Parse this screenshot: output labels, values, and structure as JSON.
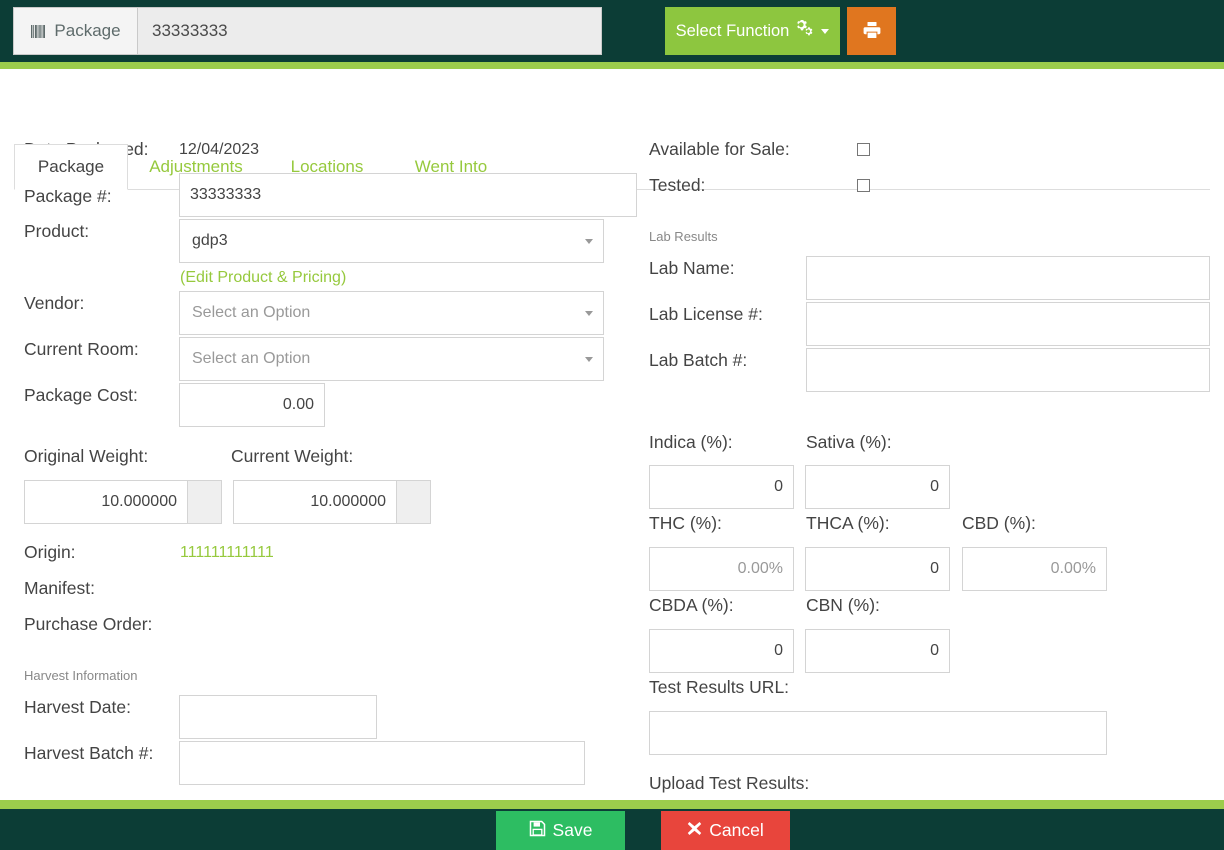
{
  "topbar": {
    "scan_label": "Package",
    "scan_icon": "barcode-icon",
    "scan_value": "33333333",
    "scan_placeholder": "",
    "select_function_label": "Select Function",
    "select_function_icon": "cogs-icon",
    "print_icon": "printer-icon"
  },
  "tabs": [
    {
      "label": "Package",
      "active": true
    },
    {
      "label": "Adjustments",
      "active": false
    },
    {
      "label": "Locations",
      "active": false
    },
    {
      "label": "Went Into",
      "active": false
    }
  ],
  "left": {
    "date_packaged_label": "Date Packaged:",
    "date_packaged_value": "12/04/2023",
    "package_num_label": "Package #:",
    "package_num_value": "33333333",
    "product_label": "Product:",
    "product_value": "gdp3",
    "edit_product_link": "(Edit Product & Pricing)",
    "vendor_label": "Vendor:",
    "vendor_value": "Select an Option",
    "current_room_label": "Current Room:",
    "current_room_value": "Select an Option",
    "package_cost_label": "Package Cost:",
    "package_cost_value": "0.00",
    "original_weight_label": "Original Weight:",
    "original_weight_value": "10.000000",
    "current_weight_label": "Current Weight:",
    "current_weight_value": "10.000000",
    "origin_label": "Origin:",
    "origin_value": "111111111111",
    "manifest_label": "Manifest:",
    "manifest_value": "",
    "purchase_order_label": "Purchase Order:",
    "purchase_order_value": "",
    "harvest_section_label": "Harvest Information",
    "harvest_date_label": "Harvest Date:",
    "harvest_date_value": "",
    "harvest_batch_label": "Harvest Batch #:",
    "harvest_batch_value": ""
  },
  "right": {
    "available_for_sale_label": "Available for Sale:",
    "available_for_sale_checked": false,
    "tested_label": "Tested:",
    "tested_checked": false,
    "lab_section_label": "Lab Results",
    "lab_name_label": "Lab Name:",
    "lab_name_value": "",
    "lab_license_label": "Lab License #:",
    "lab_license_value": "",
    "lab_batch_label": "Lab Batch #:",
    "lab_batch_value": "",
    "indica_label": "Indica (%):",
    "indica_value": "0",
    "sativa_label": "Sativa (%):",
    "sativa_value": "0",
    "thc_label": "THC (%):",
    "thc_placeholder": "0.00%",
    "thc_value": "",
    "thca_label": "THCA (%):",
    "thca_value": "0",
    "cbd_label": "CBD (%):",
    "cbd_placeholder": "0.00%",
    "cbd_value": "",
    "cbda_label": "CBDA (%):",
    "cbda_value": "0",
    "cbn_label": "CBN (%):",
    "cbn_value": "0",
    "test_results_url_label": "Test Results URL:",
    "test_results_url_value": "",
    "upload_test_results_label": "Upload Test Results:"
  },
  "footer": {
    "save_label": "Save",
    "save_icon": "floppy-disk-icon",
    "cancel_label": "Cancel",
    "cancel_icon": "x-mark-icon"
  },
  "colors": {
    "header_bg": "#0c3d36",
    "accent_green": "#9ccc4c",
    "button_green": "#8dc63f",
    "print_orange": "#e0761f",
    "save_green": "#2dbd62",
    "cancel_red": "#e8453c",
    "link_green": "#96c93d"
  }
}
